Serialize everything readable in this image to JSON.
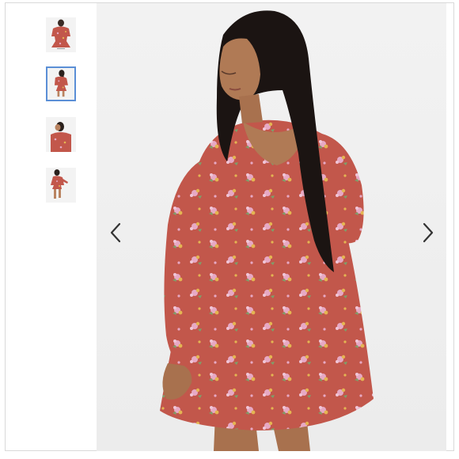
{
  "gallery": {
    "thumbnails": [
      {
        "name": "front-view",
        "active": false
      },
      {
        "name": "back-view",
        "active": true
      },
      {
        "name": "side-view",
        "active": false
      },
      {
        "name": "full-length-view",
        "active": false
      }
    ],
    "active_index": 1,
    "image_count": 4
  },
  "product": {
    "dress_color": "#c2574b",
    "floral_pink": "#e7a9c4",
    "floral_yellow": "#e4b552",
    "floral_green": "#7da06a"
  },
  "icons": {
    "prev": "chevron-left-icon",
    "next": "chevron-right-icon"
  }
}
